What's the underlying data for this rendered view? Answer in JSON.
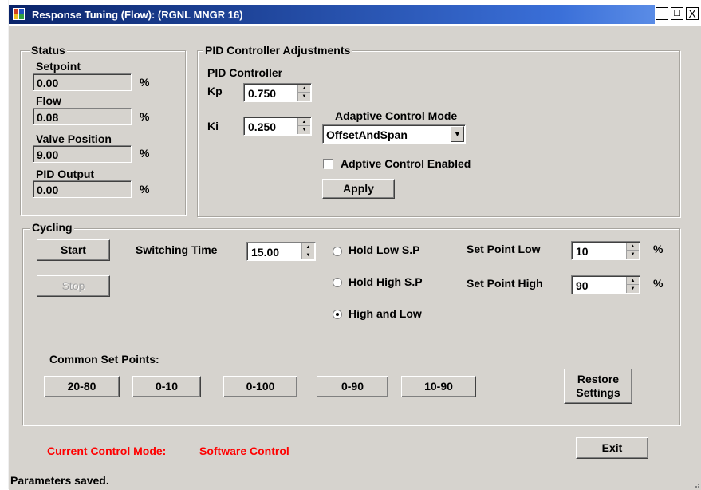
{
  "window": {
    "title": "Response Tuning (Flow): (RGNL MNGR 16)",
    "controls": {
      "minimize": "_",
      "maximize": "☐",
      "close": "X"
    }
  },
  "status": {
    "title": "Status",
    "fields": [
      {
        "label": "Setpoint",
        "value": "0.00",
        "unit": "%"
      },
      {
        "label": "Flow",
        "value": "0.08",
        "unit": "%"
      },
      {
        "label": "Valve Position",
        "value": "9.00",
        "unit": "%"
      },
      {
        "label": "PID Output",
        "value": "0.00",
        "unit": "%"
      }
    ]
  },
  "pid": {
    "title": "PID Controller Adjustments",
    "subtitle": "PID Controller",
    "kp_label": "Kp",
    "kp_value": "0.750",
    "ki_label": "Ki",
    "ki_value": "0.250",
    "adaptive_mode_label": "Adaptive Control Mode",
    "adaptive_mode_value": "OffsetAndSpan",
    "adaptive_enabled_label": "Adptive Control Enabled",
    "adaptive_enabled": false,
    "apply_label": "Apply"
  },
  "cycling": {
    "title": "Cycling",
    "start_label": "Start",
    "stop_label": "Stop",
    "switching_time_label": "Switching Time",
    "switching_time_value": "15.00",
    "radio_hold_low": "Hold Low S.P",
    "radio_hold_high": "Hold High S.P",
    "radio_high_low": "High and Low",
    "selected_mode": "High and Low",
    "sp_low_label": "Set Point Low",
    "sp_low_value": "10",
    "sp_high_label": "Set Point High",
    "sp_high_value": "90",
    "percent": "%",
    "common_label": "Common Set Points:",
    "presets": [
      "20-80",
      "0-10",
      "0-100",
      "0-90",
      "10-90"
    ],
    "restore_label": "Restore Settings"
  },
  "footer": {
    "mode_label": "Current Control Mode:",
    "mode_value": "Software Control",
    "exit_label": "Exit",
    "status_text": "Parameters saved."
  },
  "colors": {
    "caption": "#0a246a",
    "accent_red": "#ff0000",
    "face": "#d6d3ce"
  }
}
